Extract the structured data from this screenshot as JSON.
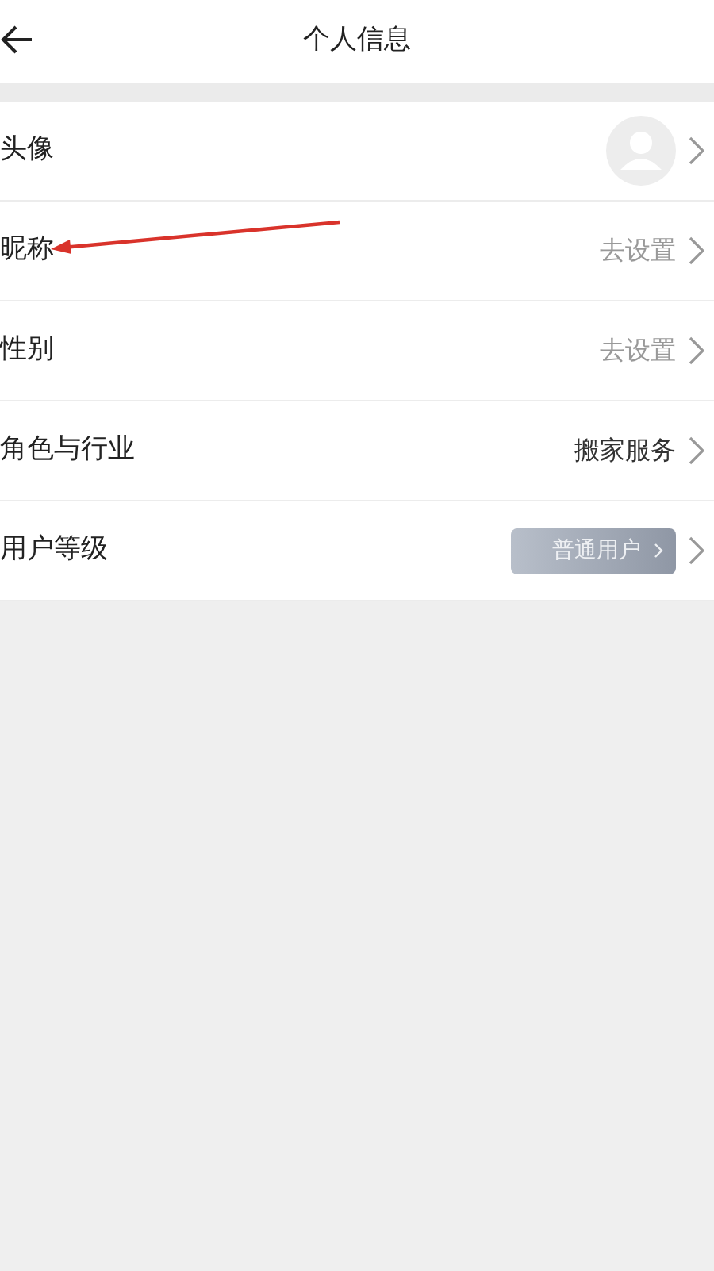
{
  "header": {
    "title": "个人信息"
  },
  "rows": [
    {
      "label": "头像",
      "kind": "avatar"
    },
    {
      "label": "昵称",
      "kind": "placeholder",
      "value": "去设置"
    },
    {
      "label": "性别",
      "kind": "placeholder",
      "value": "去设置"
    },
    {
      "label": "角色与行业",
      "kind": "value",
      "value": "搬家服务"
    },
    {
      "label": "用户等级",
      "kind": "badge",
      "value": "普通用户"
    }
  ]
}
